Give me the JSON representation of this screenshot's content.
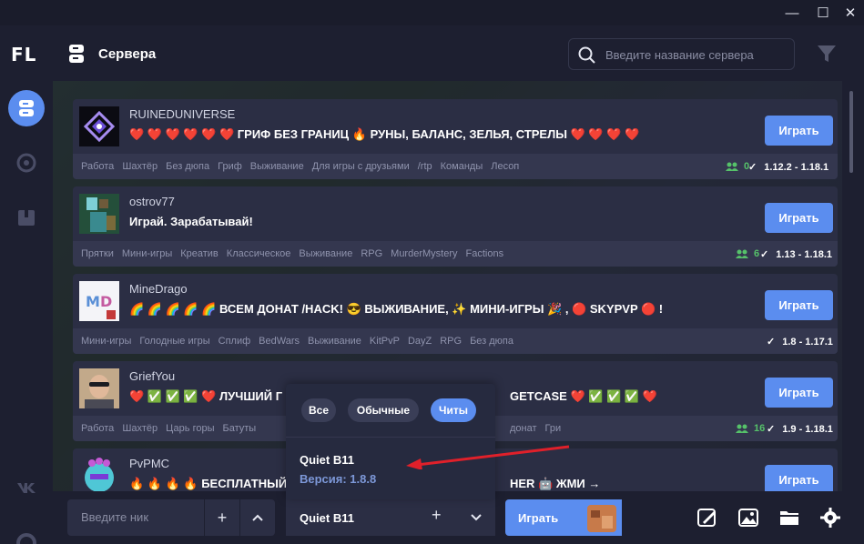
{
  "window": {
    "minimize_glyph": "—",
    "maximize_glyph": "☐",
    "close_glyph": "✕"
  },
  "app": {
    "logo": "FL"
  },
  "sidebar": {
    "items": [
      {
        "icon": "server-icon",
        "active": true
      },
      {
        "icon": "compass-icon",
        "active": false
      },
      {
        "icon": "package-icon",
        "active": false
      },
      {
        "icon": "vk-icon",
        "active": false
      },
      {
        "icon": "lifebuoy-icon",
        "active": false
      }
    ]
  },
  "header": {
    "title": "Сервера",
    "search_placeholder": "Введите название сервера"
  },
  "servers": [
    {
      "name": "RUINEDUNIVERSE",
      "description": "❤️ ❤️ ❤️ ❤️ ❤️ ❤️ ГРИФ БЕЗ ГРАНИЦ 🔥 РУНЫ, БАЛАНС, ЗЕЛЬЯ, СТРЕЛЫ ❤️ ❤️ ❤️ ❤️",
      "tags": [
        "Работа",
        "Шахтёр",
        "Без дюпа",
        "Гриф",
        "Выживание",
        "Для игры с друзьями",
        "/rtp",
        "Команды",
        "Лесоп"
      ],
      "online": "0",
      "versions": "1.12.2 - 1.18.1",
      "play_label": "Играть"
    },
    {
      "name": "ostrov77",
      "description": "Играй. Зарабатывай!",
      "tags": [
        "Прятки",
        "Мини-игры",
        "Креатив",
        "Классическое",
        "Выживание",
        "RPG",
        "MurderMystery",
        "Factions"
      ],
      "online": "6",
      "versions": "1.13 - 1.18.1",
      "play_label": "Играть"
    },
    {
      "name": "MineDrago",
      "description": "🌈 🌈 🌈 🌈 🌈 ВСЕМ ДОНАТ /HACK! 😎 ВЫЖИВАНИЕ, ✨ МИНИ-ИГРЫ 🎉 , 🔴 SKYPVP 🔴 !",
      "tags": [
        "Мини-игры",
        "Голодные игры",
        "Сплиф",
        "BedWars",
        "Выживание",
        "KitPvP",
        "DayZ",
        "RPG",
        "Без дюпа"
      ],
      "online": "",
      "versions": "1.8 - 1.17.1",
      "play_label": "Играть"
    },
    {
      "name": "GriefYou",
      "description_left": "❤️ ✅ ✅ ✅ ❤️ ЛУЧШИЙ Г",
      "description_right": "GETCASE ❤️ ✅ ✅ ✅ ❤️",
      "tags": [
        "Работа",
        "Шахтёр",
        "Царь горы",
        "Батуты"
      ],
      "tags_right": [
        "донат",
        "Гри"
      ],
      "online": "16",
      "versions": "1.9 - 1.18.1",
      "play_label": "Играть"
    },
    {
      "name": "PvPMC",
      "description_left": "🔥 🔥 🔥 🔥 БЕСПЛАТНЫЙ Л",
      "description_right": "HER 🤖 ЖМИ →",
      "play_label": "Играть"
    }
  ],
  "bottom": {
    "nick_placeholder": "Введите ник",
    "plus_glyph": "+",
    "chevron_up_glyph": "⌃",
    "chevron_down_glyph": "⌄",
    "selected_version": "Quiet B11",
    "play_label": "Играть"
  },
  "popup": {
    "filters": [
      {
        "label": "Все",
        "active": false
      },
      {
        "label": "Обычные",
        "active": false
      },
      {
        "label": "Читы",
        "active": true
      }
    ],
    "item_name": "Quiet B11",
    "item_version": "Версия: 1.8.8"
  },
  "colors": {
    "accent": "#5b8def",
    "online_green": "#56c26a",
    "card_bg": "#2b2e44",
    "annotation_arrow": "#e0202a"
  }
}
